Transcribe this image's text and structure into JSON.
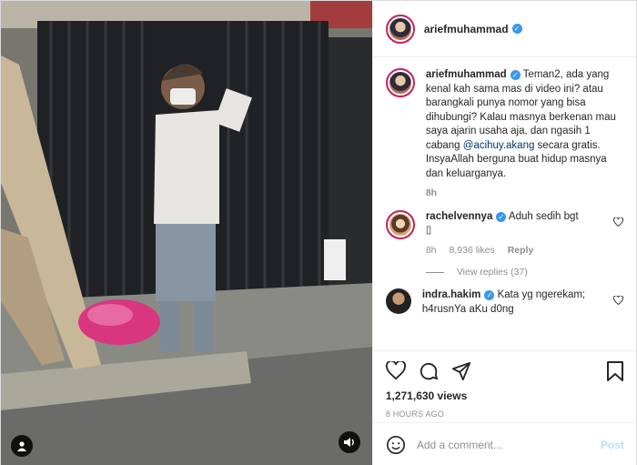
{
  "post": {
    "author": "ariefmuhammad",
    "caption": {
      "username": "ariefmuhammad",
      "text_before": "Teman2, ada yang kenal kah sama mas di video ini? atau barangkali punya nomor yang bisa dihubungi? Kalau masnya berkenan mau saya ajarin usaha aja, dan ngasih 1 cabang ",
      "mention": "@acihuy.akang",
      "text_after": " secara gratis. InsyaAllah berguna buat hidup masnya dan keluarganya.",
      "time": "8h"
    },
    "comments": [
      {
        "username": "rachelvennya",
        "text": "Aduh sedih bgt",
        "emoji": "▯",
        "time": "8h",
        "likes": "8,936 likes",
        "reply_label": "Reply",
        "view_replies": "View replies (37)"
      },
      {
        "username": "indra.hakim",
        "text": "Kata yg ngerekam; h4rusnYa aKu d0ng"
      }
    ],
    "views": "1,271,630 views",
    "posted_ago": "8 HOURS AGO",
    "add_comment_placeholder": "Add a comment...",
    "post_label": "Post"
  },
  "icons": {
    "verified": "verified-badge-icon",
    "heart": "heart-icon",
    "comment": "comment-icon",
    "share": "share-icon",
    "save": "bookmark-icon",
    "emoji": "emoji-icon",
    "user": "user-tag-icon",
    "sound": "sound-icon"
  },
  "colors": {
    "verified": "#3897f0",
    "mention": "#00376b",
    "muted": "#8e8e8e",
    "post_disabled": "#b2dffc"
  }
}
